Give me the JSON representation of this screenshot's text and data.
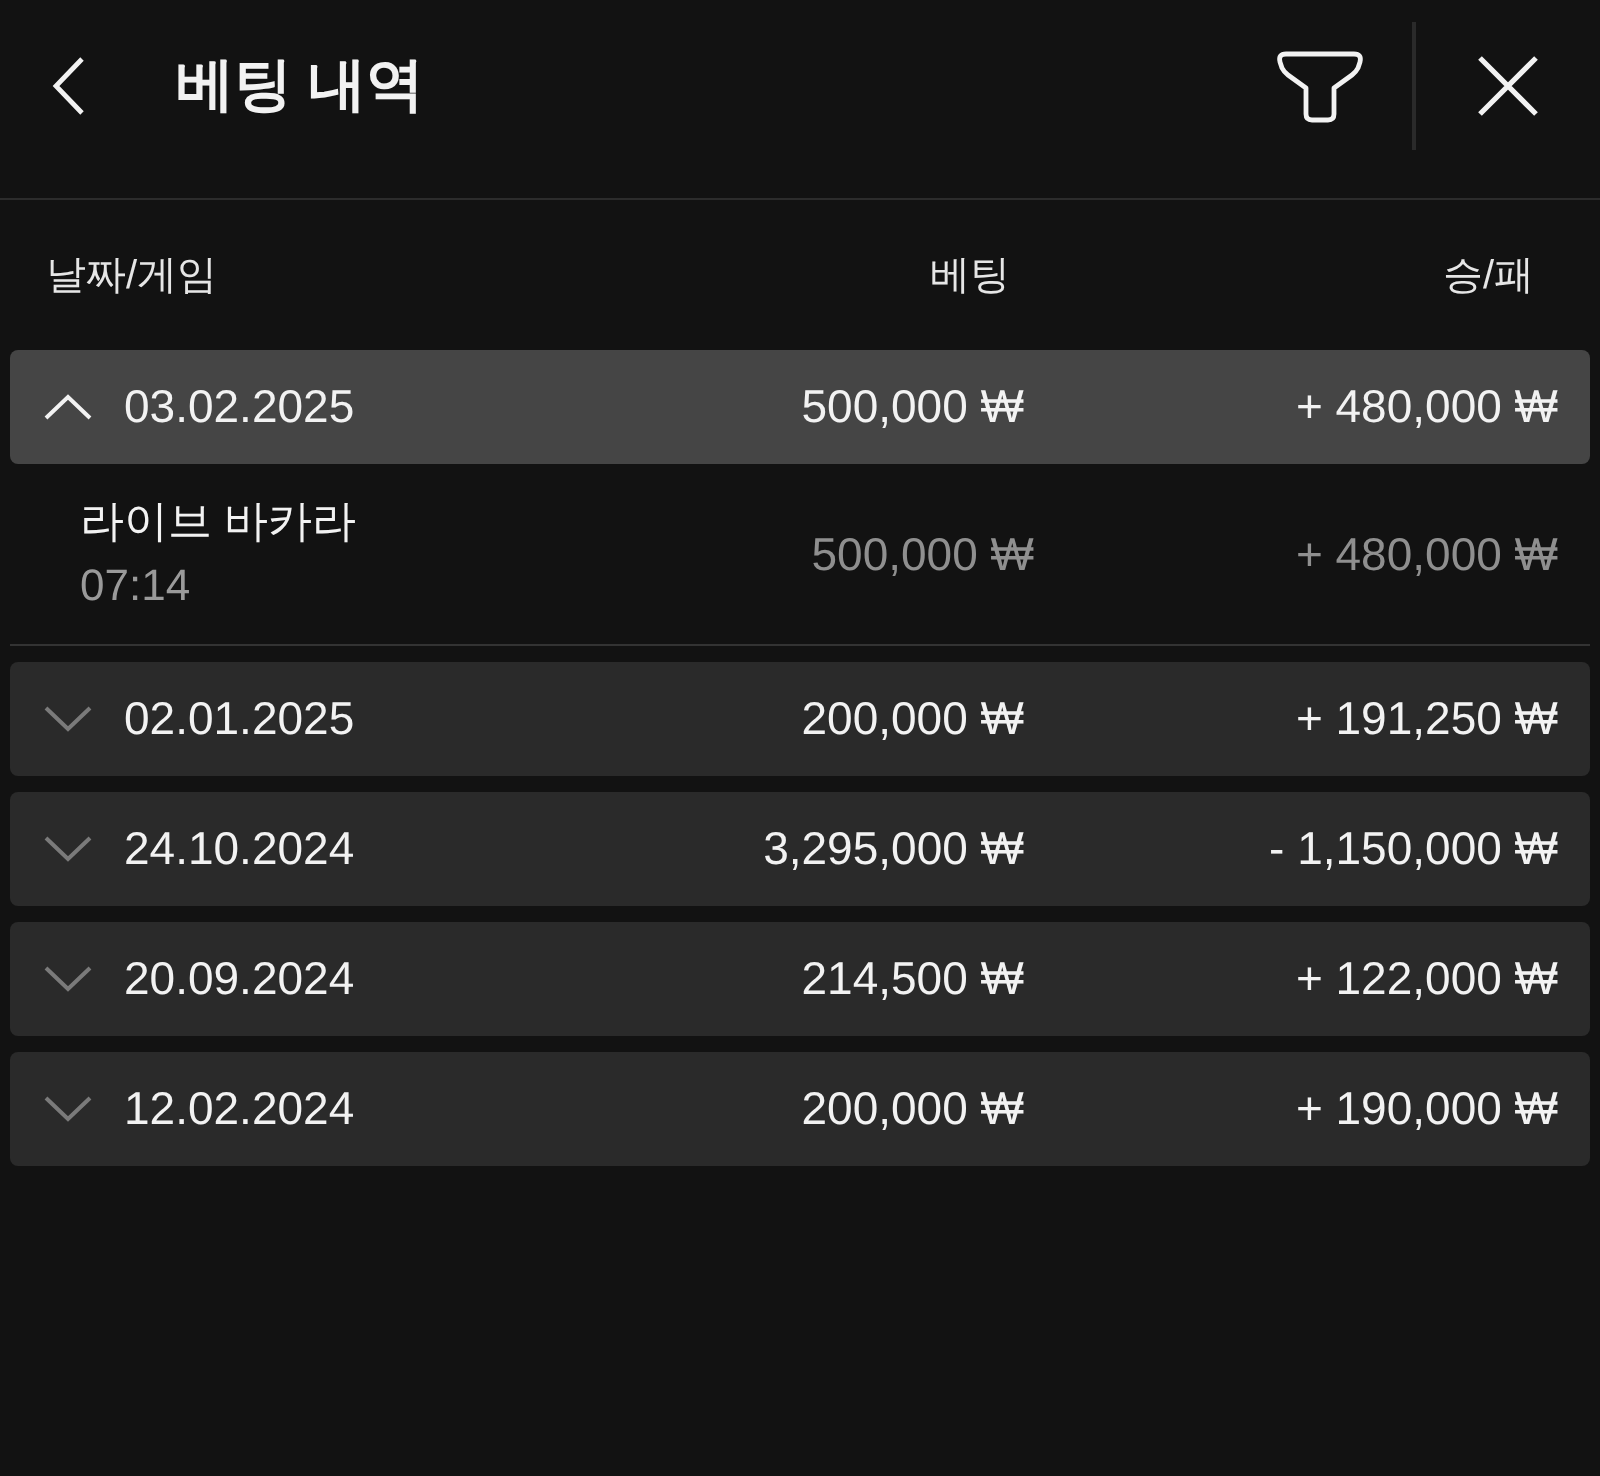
{
  "header": {
    "title": "베팅 내역"
  },
  "columns": [
    {
      "label": "날짜/게임"
    },
    {
      "label": "베팅"
    },
    {
      "label": "승/패"
    }
  ],
  "groups": [
    {
      "date": "03.02.2025",
      "bet": "500,000 ₩",
      "result": "+ 480,000 ₩",
      "expanded": true,
      "games": [
        {
          "name": "라이브 바카라",
          "time": "07:14",
          "bet": "500,000 ₩",
          "result": "+ 480,000 ₩"
        }
      ]
    },
    {
      "date": "02.01.2025",
      "bet": "200,000 ₩",
      "result": "+ 191,250 ₩",
      "expanded": false
    },
    {
      "date": "24.10.2024",
      "bet": "3,295,000 ₩",
      "result": "- 1,150,000 ₩",
      "expanded": false
    },
    {
      "date": "20.09.2024",
      "bet": "214,500 ₩",
      "result": "+ 122,000 ₩",
      "expanded": false
    },
    {
      "date": "12.02.2024",
      "bet": "200,000 ₩",
      "result": "+ 190,000 ₩",
      "expanded": false
    }
  ]
}
